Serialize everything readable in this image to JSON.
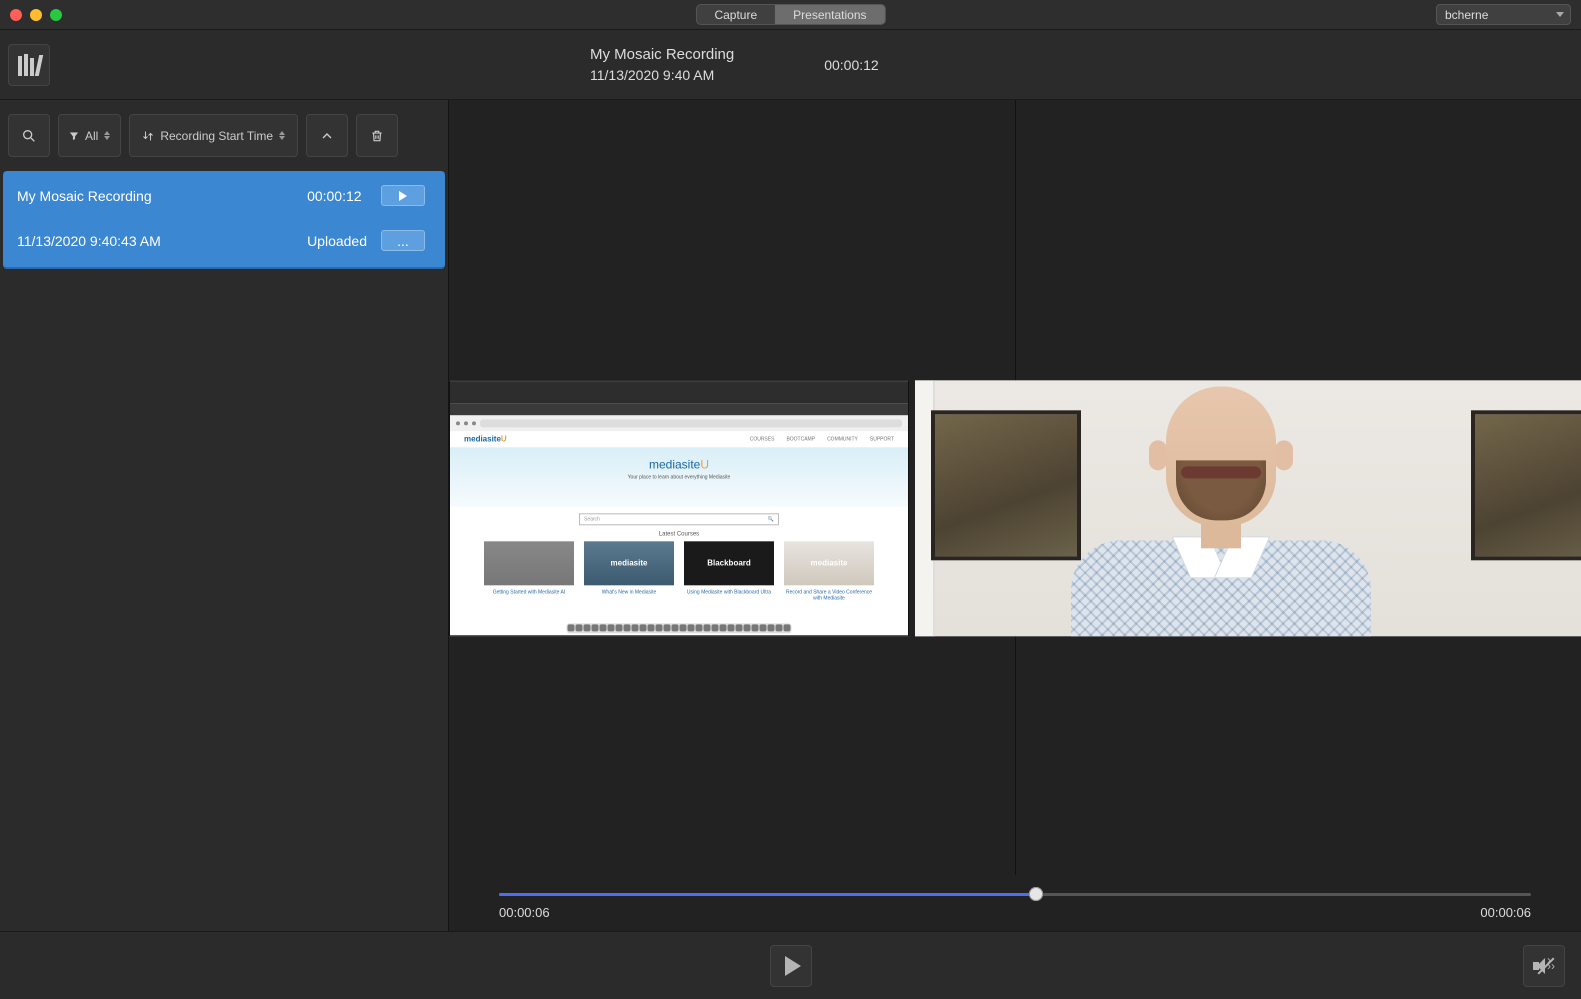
{
  "titlebar": {
    "modes": {
      "capture": "Capture",
      "presentations": "Presentations",
      "active": "presentations"
    },
    "user": "bcherne"
  },
  "header": {
    "title": "My Mosaic Recording",
    "datetime": "11/13/2020 9:40 AM",
    "duration": "00:00:12"
  },
  "sidebar": {
    "filter_label": "All",
    "sort_label": "Recording Start Time",
    "items": [
      {
        "name": "My Mosaic Recording",
        "duration": "00:00:12",
        "timestamp": "11/13/2020 9:40:43 AM",
        "status": "Uploaded",
        "more_label": "..."
      }
    ]
  },
  "screen_preview": {
    "brand_main": "mediasite",
    "brand_accent": "U",
    "tagline": "Your place to learn about everything Mediasite",
    "search_placeholder": "Search",
    "nav": [
      "COURSES",
      "BOOTCAMP",
      "COMMUNITY",
      "SUPPORT"
    ],
    "section": "Latest Courses",
    "courses": [
      {
        "thumb_text": "",
        "caption": "Getting Started with Mediasite AI"
      },
      {
        "thumb_text": "mediasite",
        "caption": "What's New in Mediasite"
      },
      {
        "thumb_text": "Blackboard",
        "caption": "Using Mediasite with Blackboard Ultra"
      },
      {
        "thumb_text": "mediasite",
        "caption": "Record and Share a Video Conference with Mediasite"
      }
    ]
  },
  "timeline": {
    "current": "00:00:06",
    "total": "00:00:06",
    "progress_pct": 52
  }
}
